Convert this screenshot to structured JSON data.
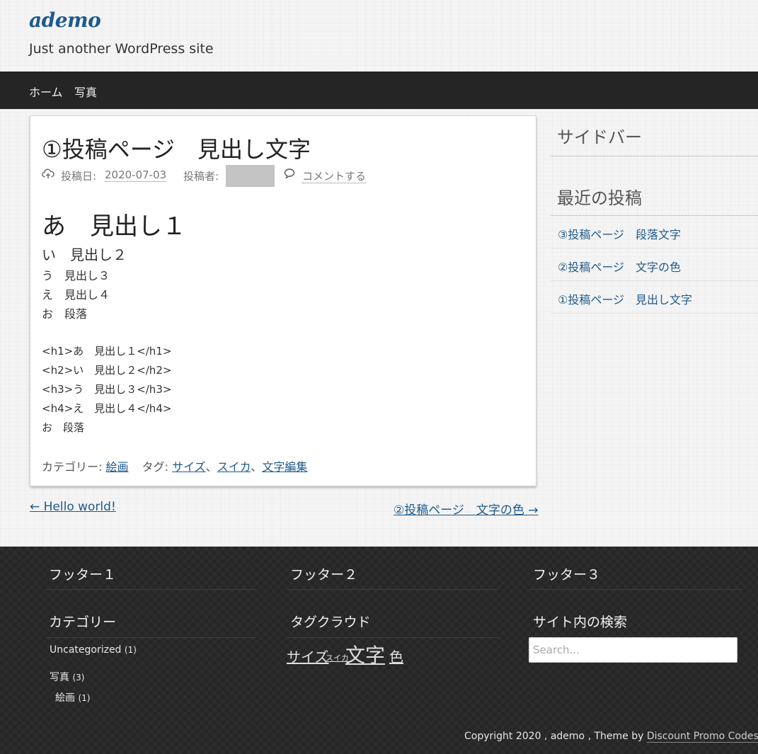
{
  "header": {
    "site_title": "ademo",
    "site_description": "Just another WordPress site"
  },
  "nav": {
    "items": [
      {
        "label": "ホーム"
      },
      {
        "label": "写真"
      }
    ]
  },
  "article": {
    "title": "①投稿ページ　見出し文字",
    "meta": {
      "date_label": "投稿日:",
      "date": "2020-07-03",
      "author_label": "投稿者:",
      "comment_label": "コメントする"
    },
    "content": {
      "h1": "あ　見出し１",
      "h2": "い　見出し２",
      "h3": "う　見出し３",
      "h4": "え　見出し４",
      "p": "お　段落",
      "code_lines": [
        "<h1>あ　見出し１</h1>",
        "<h2>い　見出し２</h2>",
        "<h3>う　見出し３</h3>",
        "<h4>え　見出し４</h4>",
        "お　段落"
      ]
    },
    "footer": {
      "category_label": "カテゴリー:",
      "category": "絵画",
      "tag_label": "タグ:",
      "tags": [
        "サイズ",
        "スイカ",
        "文字編集"
      ],
      "tag_separator": "、"
    }
  },
  "post_nav": {
    "prev": "← Hello world!",
    "next": "②投稿ページ　文字の色 →"
  },
  "sidebar": {
    "title": "サイドバー",
    "recent_title": "最近の投稿",
    "recent_posts": [
      {
        "label": "③投稿ページ　段落文字"
      },
      {
        "label": "②投稿ページ　文字の色"
      },
      {
        "label": "①投稿ページ　見出し文字"
      }
    ]
  },
  "footer": {
    "col1_title": "フッター１",
    "col2_title": "フッター２",
    "col3_title": "フッター３",
    "categories_title": "カテゴリー",
    "categories": [
      {
        "label": "Uncategorized",
        "count": "(1)"
      },
      {
        "label": "写真",
        "count": "(3)"
      },
      {
        "label": "絵画",
        "count": "(1)"
      }
    ],
    "tag_cloud_title": "タグクラウド",
    "tags": [
      {
        "label": "サイズ"
      },
      {
        "label": "スイカ"
      },
      {
        "label": "文字"
      },
      {
        "label": "色"
      }
    ],
    "search_title": "サイト内の検索",
    "search_placeholder": "Search...",
    "copyright_text": "Copyright 2020 , ademo , Theme by ",
    "copyright_link": "Discount Promo Codes"
  }
}
